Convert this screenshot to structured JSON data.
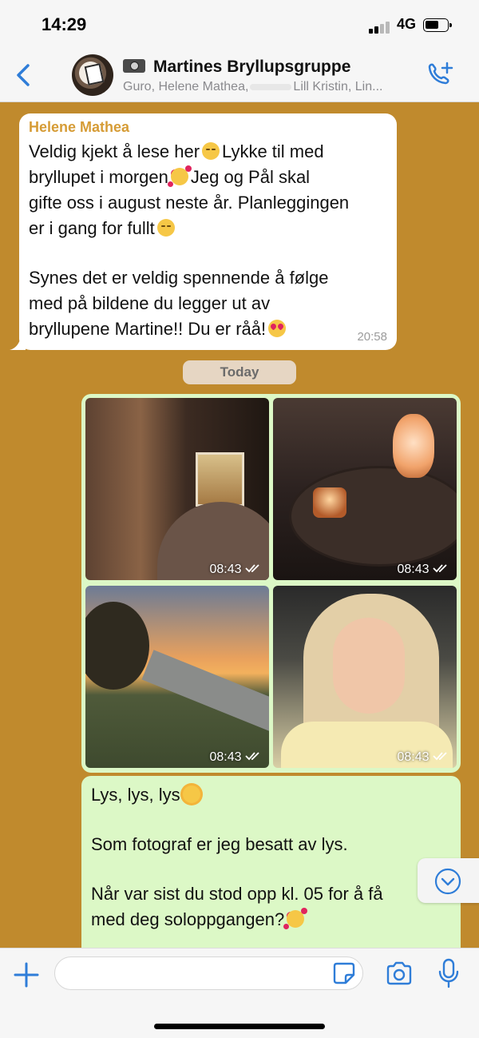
{
  "status_bar": {
    "time": "14:29",
    "network": "4G"
  },
  "header": {
    "title": "Martines Bryllupsgruppe",
    "members_before": "Guro, Helene Mathea,",
    "members_after": "Lill Kristin, Lin..."
  },
  "messages": {
    "incoming": {
      "sender": "Helene Mathea",
      "line1": "Veldig kjekt å lese her",
      "line2": "Lykke til med",
      "line3": "bryllupet i morgen",
      "line4": "Jeg og Pål skal",
      "line5": "gifte oss i august neste år. Planleggingen",
      "line6": "er i gang for fullt",
      "line7": "Synes det er veldig spennende å følge",
      "line8": "med på bildene du legger ut av",
      "line9": "bryllupene Martine!! Du er råå!",
      "time": "20:58"
    },
    "date_divider": "Today",
    "photos": [
      {
        "time": "08:43"
      },
      {
        "time": "08:43"
      },
      {
        "time": "08:43"
      },
      {
        "time": "08:43"
      }
    ],
    "outgoing": {
      "line1": "Lys, lys, lys",
      "line2": "Som fotograf er jeg besatt av lys.",
      "line3": "Når var sist du stod opp kl. 05 for å få",
      "line4": "med deg soloppgangen?"
    }
  },
  "icons": {
    "back": "chevron-left-icon",
    "call": "add-call-icon",
    "scroll": "chevron-down-circle-icon",
    "plus": "plus-icon",
    "sticker": "sticker-icon",
    "camera": "camera-icon",
    "mic": "microphone-icon"
  },
  "colors": {
    "accent": "#2f7dd8",
    "chat_background": "#c08a2d",
    "outgoing_bubble": "#dcf8c6",
    "sender_name": "#d69c36"
  }
}
